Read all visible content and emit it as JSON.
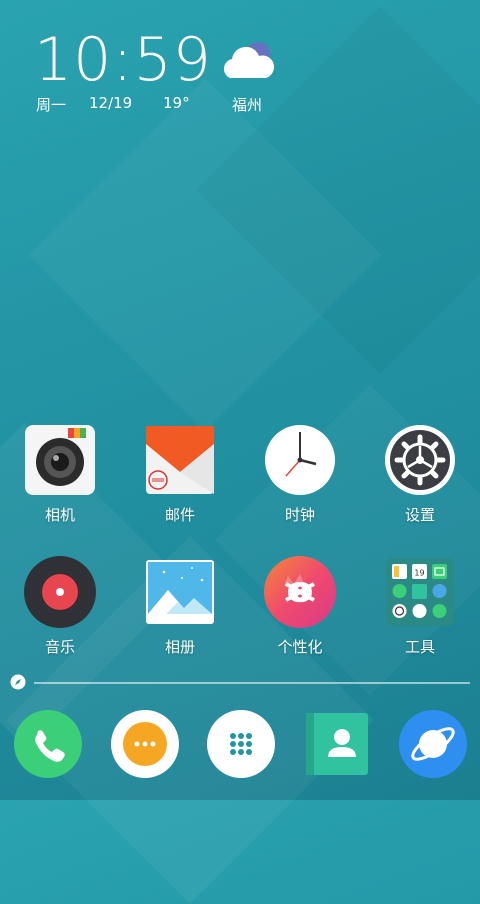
{
  "status": {
    "time": "10:59",
    "weekday": "周一",
    "date": "12/19",
    "temperature": "19°",
    "city": "福州",
    "weather_icon": "cloud-icon"
  },
  "apps_row1": [
    {
      "label": "相机",
      "icon": "camera-icon"
    },
    {
      "label": "邮件",
      "icon": "mail-icon"
    },
    {
      "label": "时钟",
      "icon": "clock-icon"
    },
    {
      "label": "设置",
      "icon": "settings-gear-icon"
    }
  ],
  "apps_row2": [
    {
      "label": "音乐",
      "icon": "music-disc-icon"
    },
    {
      "label": "相册",
      "icon": "gallery-icon"
    },
    {
      "label": "个性化",
      "icon": "personalize-infinity-icon"
    },
    {
      "label": "工具",
      "icon": "tools-folder-icon"
    }
  ],
  "dock": [
    {
      "icon": "phone-icon",
      "color": "#3ccf7a"
    },
    {
      "icon": "messages-icon",
      "color": "#ffffff"
    },
    {
      "icon": "app-drawer-icon",
      "color": "#ffffff"
    },
    {
      "icon": "contacts-icon",
      "color": "#31c29f"
    },
    {
      "icon": "browser-icon",
      "color": "#2e8ff0"
    }
  ],
  "tools_folder_date": "19"
}
